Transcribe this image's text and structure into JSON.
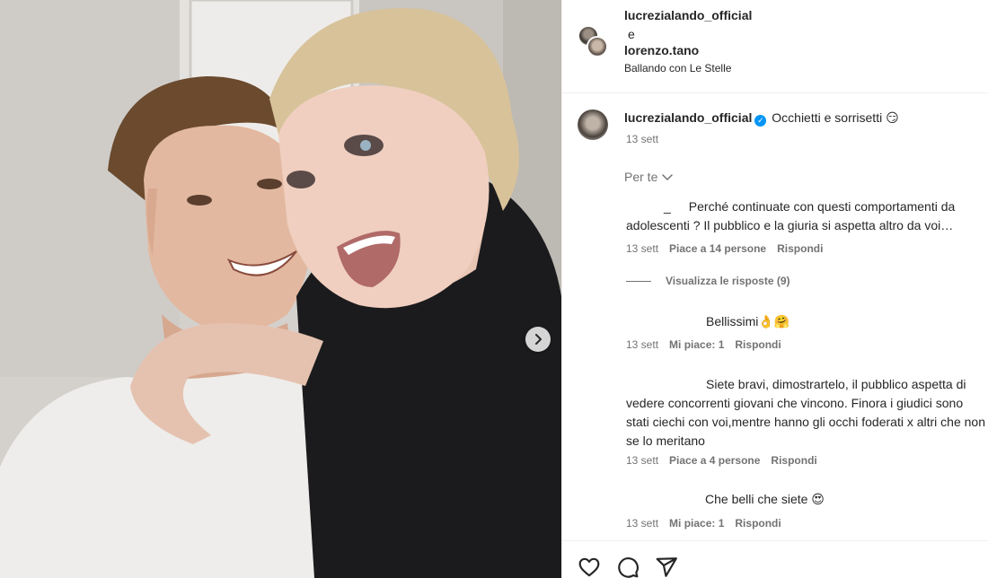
{
  "post": {
    "author": "lucrezialando_official",
    "conjunction": "e",
    "coauthor": "lorenzo.tano",
    "audio": "Ballando con Le Stelle"
  },
  "caption": {
    "username": "lucrezialando_official",
    "verified_icon": "verified-badge-icon",
    "text": "Occhietti e sorrisetti 😏",
    "time": "13 sett"
  },
  "sort_label": "Per te",
  "comments": [
    {
      "username": "_",
      "text": "Perché continuate con questi comportamenti da adolescenti ? Il pubblico e la giuria si aspetta altro da voi…",
      "time": "13 sett",
      "likes": "Piace a 14 persone",
      "reply": "Rispondi",
      "view_replies": "Visualizza le risposte (9)"
    },
    {
      "text": "Bellissimi👌🤗",
      "time": "13 sett",
      "likes": "Mi piace: 1",
      "reply": "Rispondi"
    },
    {
      "text": "Siete bravi, dimostrartelo, il pubblico aspetta di vedere concorrenti giovani che vincono. Finora i giudici sono stati ciechi con voi,mentre hanno gli occhi foderati x altri che non se lo meritano",
      "time": "13 sett",
      "likes": "Piace a 4 persone",
      "reply": "Rispondi"
    },
    {
      "text": "Che belli che siete 😍",
      "time": "13 sett",
      "likes": "Mi piace: 1",
      "reply": "Rispondi"
    }
  ],
  "icons": {
    "next": "chevron-right-icon",
    "like": "heart-icon",
    "comment": "comment-bubble-icon",
    "share": "paper-plane-icon",
    "sort": "chevron-down-icon"
  },
  "colors": {
    "text": "#262626",
    "secondary": "#737373",
    "verified": "#0095f6",
    "divider": "#efefef"
  }
}
